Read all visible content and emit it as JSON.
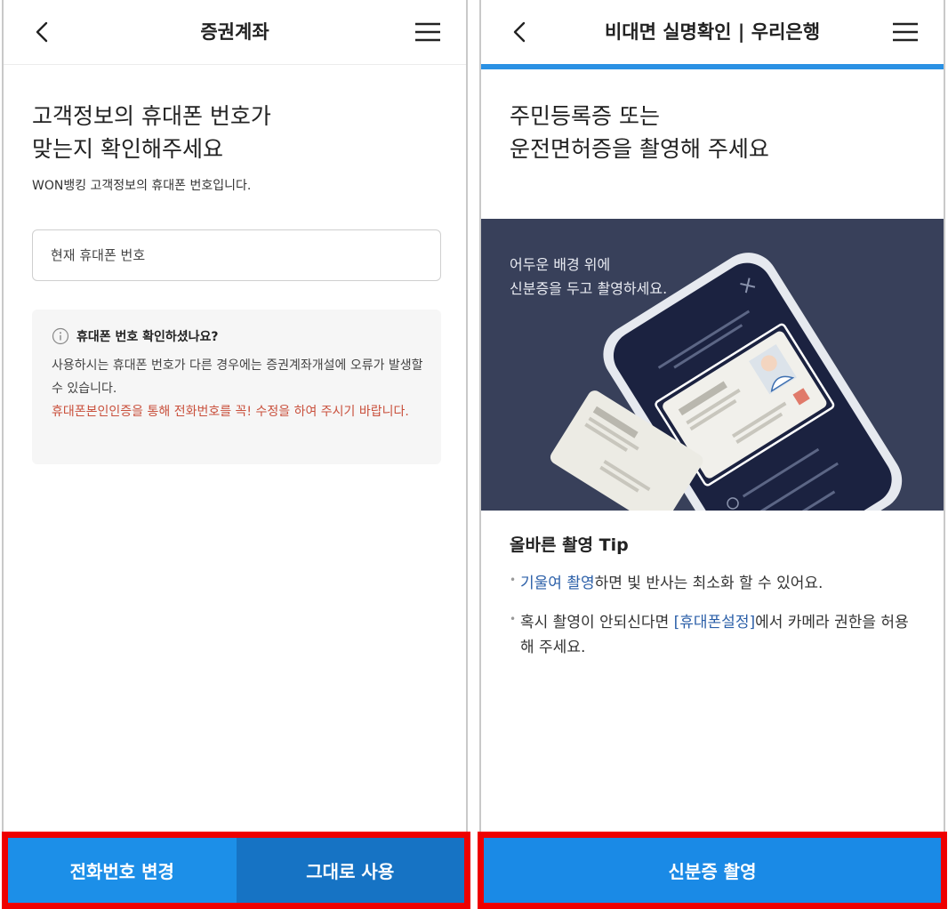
{
  "left_screen": {
    "header": {
      "title": "증권계좌"
    },
    "headline": {
      "line1": "고객정보의 휴대폰 번호가",
      "line2": "맞는지 확인해주세요"
    },
    "subtext": "WON뱅킹 고객정보의 휴대폰 번호입니다.",
    "phone_input": {
      "placeholder": "현재 휴대폰 번호",
      "value": ""
    },
    "notice": {
      "title": "휴대폰 번호 확인하셨나요?",
      "body": "사용하시는 휴대폰 번호가 다른 경우에는 증권계좌개설에 오류가 발생할 수 있습니다.",
      "warning": "휴대폰본인인증을 통해 전화번호를 꼭! 수정을 하여 주시기 바랍니다."
    },
    "buttons": {
      "change": "전화번호 변경",
      "use": "그대로 사용"
    }
  },
  "right_screen": {
    "header": {
      "title": "비대면 실명확인 | 우리은행"
    },
    "headline": {
      "line1": "주민등록증 또는",
      "line2": "운전면허증을 촬영해 주세요"
    },
    "illustration": {
      "line1": "어두운 배경 위에",
      "line2": "신분증을 두고 촬영하세요."
    },
    "tip": {
      "title": "올바른 촬영 Tip",
      "item1": {
        "link": "기울여 촬영",
        "rest": "하면 빛 반사는 최소화 할 수 있어요."
      },
      "item2": {
        "pre": "혹시 촬영이 안되신다면 ",
        "link": "[휴대폰설정]",
        "rest": "에서 카메라 권한을 허용해 주세요."
      }
    },
    "buttons": {
      "capture": "신분증 촬영"
    }
  },
  "colors": {
    "accent_blue": "#1c8fe8",
    "progress_bar": "#2b91e4",
    "warning_red": "#c9503c",
    "link_blue": "#2b5fa8",
    "illustration_bg": "#38405a",
    "highlight_border": "#ee0000"
  },
  "icons": [
    "chevron-left-icon",
    "hamburger-menu-icon",
    "info-circle-icon"
  ]
}
